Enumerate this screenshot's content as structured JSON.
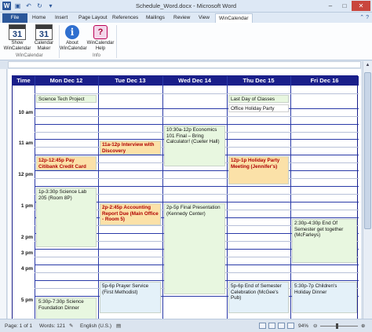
{
  "window": {
    "title": "Schedule_Word.docx  -  Microsoft Word",
    "controls": [
      "–",
      "□",
      "✕"
    ],
    "app_icon": "word-icon",
    "quick_access": [
      "save-icon",
      "undo-icon",
      "redo-icon",
      "customize-icon"
    ]
  },
  "tabs": [
    "File",
    "Home",
    "Insert",
    "Page Layout",
    "References",
    "Mailings",
    "Review",
    "View",
    "WinCalendar"
  ],
  "active_tab": "WinCalendar",
  "ribbon": {
    "buttons": [
      {
        "label1": "Show",
        "label2": "WinCalendar",
        "icon": "calendar-icon",
        "num": "31"
      },
      {
        "label1": "Calendar",
        "label2": "Maker",
        "icon": "calendar-maker-icon",
        "num": "31"
      },
      {
        "label1": "About",
        "label2": "WinCalendar",
        "icon": "info-icon",
        "glyph": "i"
      },
      {
        "label1": "WinCalendar",
        "label2": "Help",
        "icon": "help-icon",
        "glyph": "?"
      }
    ],
    "groups": [
      "WinCalendar",
      "Info"
    ]
  },
  "calendar": {
    "headers": [
      "Time",
      "Mon Dec 12",
      "Tue Dec 13",
      "Wed Dec 14",
      "Thu Dec 15",
      "Fri Dec 16"
    ],
    "times": [
      "10 am",
      "11 am",
      "12 pm",
      "1 pm",
      "2 pm",
      "3 pm",
      "4 pm",
      "5 pm"
    ],
    "events": [
      {
        "text": "Science Tech Project Due",
        "style": "green"
      },
      {
        "text": "Last Day of Classes",
        "style": "green"
      },
      {
        "text": "Office Holiday Party",
        "style": "plain"
      },
      {
        "text": "10:30a-12p Economics 101 Final – Bring Calculator! (Cueter Hall)",
        "style": "green"
      },
      {
        "text": "11a-12p Interview with Discovery",
        "style": "orange"
      },
      {
        "text": "12p-12:45p Pay Citibank Credit Card",
        "style": "orange"
      },
      {
        "text": "12p-1p Holiday Party Meeting (Jennifer's)",
        "style": "orange"
      },
      {
        "text": "1p-3:30p Science Lab 205 (Room 8P)",
        "style": "green"
      },
      {
        "text": "2p-5p Final Presentation (Kennedy Center)",
        "style": "green"
      },
      {
        "text": "2p-2:45p Accounting Report Due (Main Office - Room 5)",
        "style": "orange"
      },
      {
        "text": "2:30p-4:30p End Of Semester get together (McFarleys)",
        "style": "green"
      },
      {
        "text": "5p-6p Prayer Service (First Methodist)",
        "style": "blue"
      },
      {
        "text": "5p-6p End of Semester Celebration (McGee's Pub)",
        "style": "blue"
      },
      {
        "text": "5:30p-7:30p Science Foundation Dinner",
        "style": "green"
      },
      {
        "text": "5:30p-7p Children's Holiday Dinner",
        "style": "blue"
      }
    ]
  },
  "statusbar": {
    "page": "Page: 1 of 1",
    "words": "Words: 121",
    "language": "English (U.S.)",
    "zoom": "94%",
    "zoom_fraction": 0.47
  },
  "colors": {
    "header_bg": "#1a1f8a",
    "event_green": "#e8f7e0",
    "event_orange": "#fbe1a8",
    "event_orange_text": "#b00000",
    "event_blue": "#e4f1f9",
    "file_tab": "#2b579a"
  }
}
